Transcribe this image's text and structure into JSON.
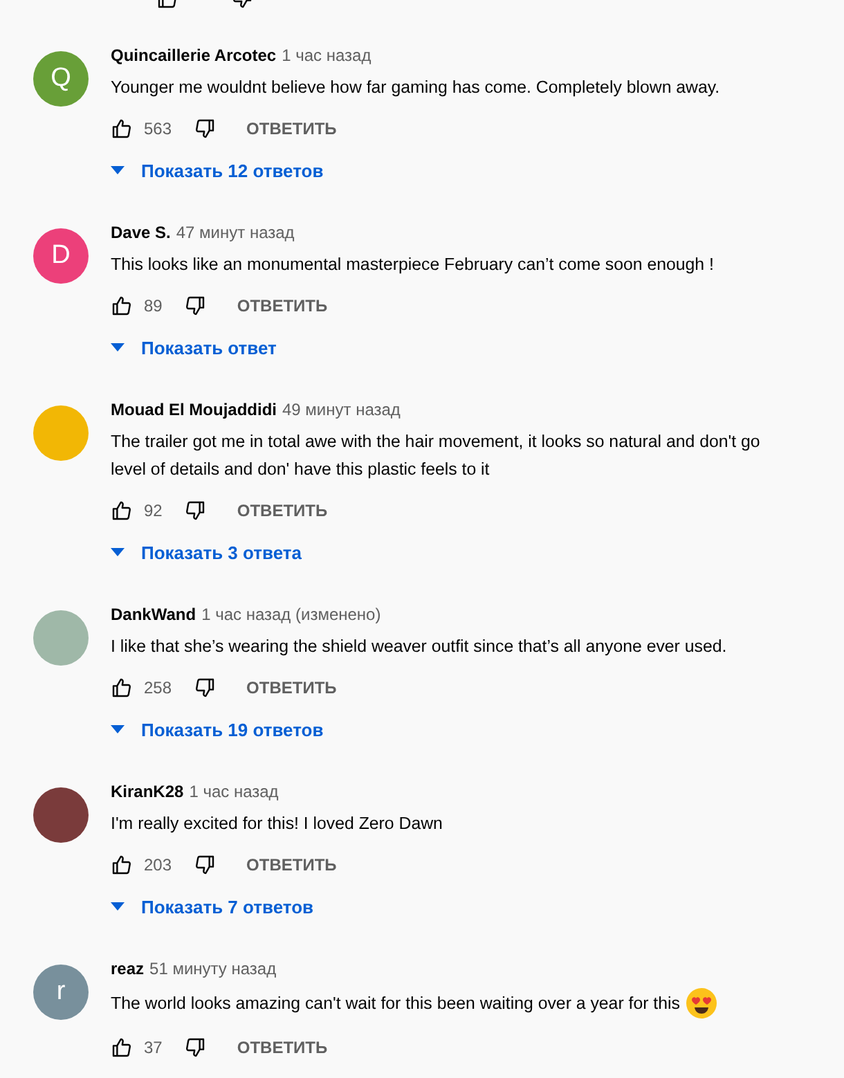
{
  "comments": [
    {
      "avatar": {
        "kind": "letter",
        "letter": "Q",
        "color": "#689f38"
      },
      "author": "Quincaillerie Arcotec",
      "time": "1 час назад",
      "lines": [
        "Younger me wouldnt believe how far gaming has come. Completely blown away."
      ],
      "likes": "563",
      "reply": "ОТВЕТИТЬ",
      "replies": "Показать 12 ответов"
    },
    {
      "avatar": {
        "kind": "letter",
        "letter": "D",
        "color": "#ec407a"
      },
      "author": "Dave S.",
      "time": "47 минут назад",
      "lines": [
        "This looks like an monumental masterpiece February can’t come soon enough !"
      ],
      "likes": "89",
      "reply": "ОТВЕТИТЬ",
      "replies": "Показать ответ"
    },
    {
      "avatar": {
        "kind": "photo",
        "color": "#f2b705"
      },
      "author": "Mouad El Moujaddidi",
      "time": "49 минут назад",
      "lines": [
        "The trailer got me in total awe with the hair movement, it looks so natural and don't go",
        "level of details and don' have this plastic feels to it"
      ],
      "likes": "92",
      "reply": "ОТВЕТИТЬ",
      "replies": "Показать 3 ответа"
    },
    {
      "avatar": {
        "kind": "photo",
        "color": "#9fb8a8"
      },
      "author": "DankWand",
      "time": "1 час назад (изменено)",
      "lines": [
        "I like that she’s wearing the shield weaver outfit since that’s all anyone ever used."
      ],
      "likes": "258",
      "reply": "ОТВЕТИТЬ",
      "replies": "Показать 19 ответов"
    },
    {
      "avatar": {
        "kind": "photo",
        "color": "#7a3b3b"
      },
      "author": "KiranK28",
      "time": "1 час назад",
      "lines": [
        "I'm really excited for this! I loved Zero Dawn"
      ],
      "likes": "203",
      "reply": "ОТВЕТИТЬ",
      "replies": "Показать 7 ответов"
    },
    {
      "avatar": {
        "kind": "letter",
        "letter": "r",
        "color": "#78909c"
      },
      "author": "reaz",
      "time": "51 минуту назад",
      "lines": [
        "The world looks amazing can't wait for this been waiting over a year for this"
      ],
      "emoji": true,
      "likes": "37",
      "reply": "ОТВЕТИТЬ"
    }
  ]
}
